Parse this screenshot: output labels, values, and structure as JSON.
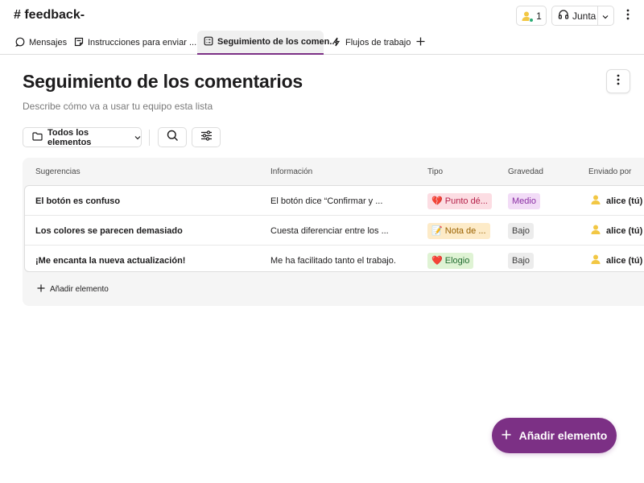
{
  "header": {
    "channel_title": "# feedback-",
    "member_count": "1",
    "huddle_label": "Junta"
  },
  "tabs": [
    {
      "label": "Mensajes",
      "icon": "message-icon"
    },
    {
      "label": "Instrucciones para enviar ...",
      "icon": "canvas-icon"
    },
    {
      "label": "Seguimiento de los comen..",
      "icon": "list-icon",
      "active": true
    },
    {
      "label": "Flujos de trabajo",
      "icon": "workflow-icon"
    }
  ],
  "page": {
    "title": "Seguimiento de los comentarios",
    "description": "Describe cómo va a usar tu equipo esta lista"
  },
  "toolbar": {
    "view_label": "Todos los elementos"
  },
  "table": {
    "columns": [
      "Sugerencias",
      "Información",
      "Tipo",
      "Gravedad",
      "Enviado por"
    ],
    "rows": [
      {
        "title": "El botón es confuso",
        "info": "El botón dice “Confirmar y ...",
        "type": {
          "emoji": "💔",
          "label": "Punto dé...",
          "bg": "#fcdde3",
          "color": "#b5224a"
        },
        "severity": {
          "label": "Medio",
          "bg": "#f2dcf7",
          "color": "#8a2fa3"
        },
        "user": "alice (tú)"
      },
      {
        "title": "Los colores se parecen demasiado",
        "info": "Cuesta diferenciar entre los ...",
        "type": {
          "emoji": "📝",
          "label": "Nota de ...",
          "bg": "#fdebc8",
          "color": "#9a6100"
        },
        "severity": {
          "label": "Bajo",
          "bg": "#ececec",
          "color": "#3d3d3d"
        },
        "user": "alice (tú)"
      },
      {
        "title": "¡Me encanta la nueva actualización!",
        "info": "Me ha facilitado tanto el trabajo.",
        "type": {
          "emoji": "❤️",
          "label": "Elogio",
          "bg": "#dff3d4",
          "color": "#1f6b2e"
        },
        "severity": {
          "label": "Bajo",
          "bg": "#ececec",
          "color": "#3d3d3d"
        },
        "user": "alice (tú)"
      }
    ],
    "add_label": "Añadir elemento"
  },
  "fab": {
    "label": "Añadir elemento"
  },
  "colors": {
    "accent": "#7c3085",
    "avatar": "#f2c744",
    "online": "#2bac76"
  }
}
